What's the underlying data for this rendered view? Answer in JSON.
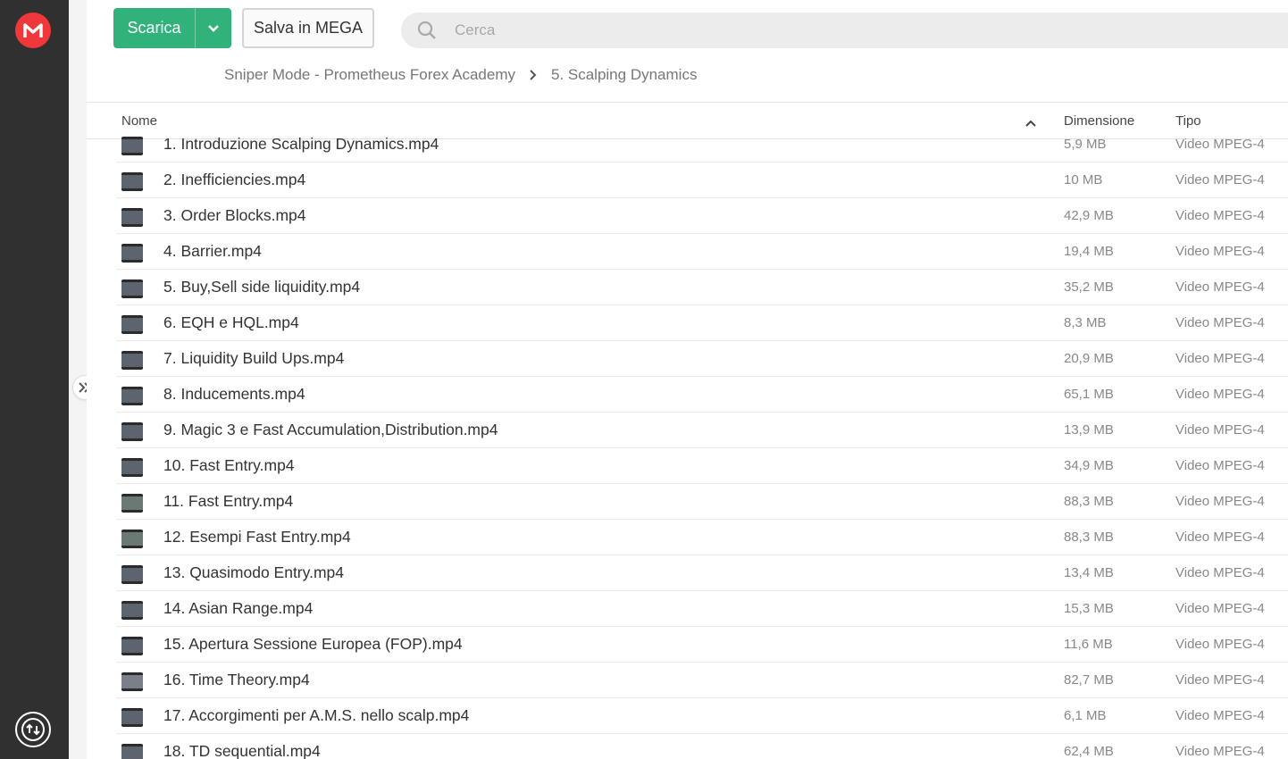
{
  "toolbar": {
    "download_label": "Scarica",
    "save_label": "Salva in MEGA",
    "search_placeholder": "Cerca"
  },
  "breadcrumb": {
    "parent": "Sniper Mode - Prometheus Forex Academy",
    "current": "5. Scalping Dynamics"
  },
  "table": {
    "headers": {
      "name": "Nome",
      "size": "Dimensione",
      "type": "Tipo"
    },
    "rows": [
      {
        "name": "1. Introduzione Scalping Dynamics.mp4",
        "size": "5,9 MB",
        "type": "Video MPEG-4"
      },
      {
        "name": "2. Inefficiencies.mp4",
        "size": "10 MB",
        "type": "Video MPEG-4"
      },
      {
        "name": "3. Order Blocks.mp4",
        "size": "42,9 MB",
        "type": "Video MPEG-4"
      },
      {
        "name": "4. Barrier.mp4",
        "size": "19,4 MB",
        "type": "Video MPEG-4"
      },
      {
        "name": "5. Buy,Sell side liquidity.mp4",
        "size": "35,2 MB",
        "type": "Video MPEG-4"
      },
      {
        "name": "6. EQH e HQL.mp4",
        "size": "8,3 MB",
        "type": "Video MPEG-4"
      },
      {
        "name": "7. Liquidity Build Ups.mp4",
        "size": "20,9 MB",
        "type": "Video MPEG-4"
      },
      {
        "name": "8. Inducements.mp4",
        "size": "65,1 MB",
        "type": "Video MPEG-4"
      },
      {
        "name": "9. Magic 3 e Fast Accumulation,Distribution.mp4",
        "size": "13,9 MB",
        "type": "Video MPEG-4"
      },
      {
        "name": "10. Fast Entry.mp4",
        "size": "34,9 MB",
        "type": "Video MPEG-4"
      },
      {
        "name": "11. Fast Entry.mp4",
        "size": "88,3 MB",
        "type": "Video MPEG-4"
      },
      {
        "name": "12. Esempi Fast Entry.mp4",
        "size": "88,3 MB",
        "type": "Video MPEG-4"
      },
      {
        "name": "13. Quasimodo Entry.mp4",
        "size": "13,4 MB",
        "type": "Video MPEG-4"
      },
      {
        "name": "14. Asian Range.mp4",
        "size": "15,3 MB",
        "type": "Video MPEG-4"
      },
      {
        "name": "15. Apertura Sessione Europea (FOP).mp4",
        "size": "11,6 MB",
        "type": "Video MPEG-4"
      },
      {
        "name": "16. Time Theory.mp4",
        "size": "82,7 MB",
        "type": "Video MPEG-4"
      },
      {
        "name": "17. Accorgimenti per A.M.S. nello scalp.mp4",
        "size": "6,1 MB",
        "type": "Video MPEG-4"
      },
      {
        "name": "18. TD sequential.mp4",
        "size": "62,4 MB",
        "type": "Video MPEG-4"
      }
    ]
  },
  "colors": {
    "brand": "#f0373a",
    "download_button": "#31b27a",
    "rail": "#303030"
  },
  "icons": [
    "mega-logo-icon",
    "chevron-down-icon",
    "search-icon",
    "chevron-right-icon",
    "sort-ascending-icon",
    "video-thumbnail-icon",
    "expand-sidebar-icon",
    "transfer-manager-icon"
  ]
}
